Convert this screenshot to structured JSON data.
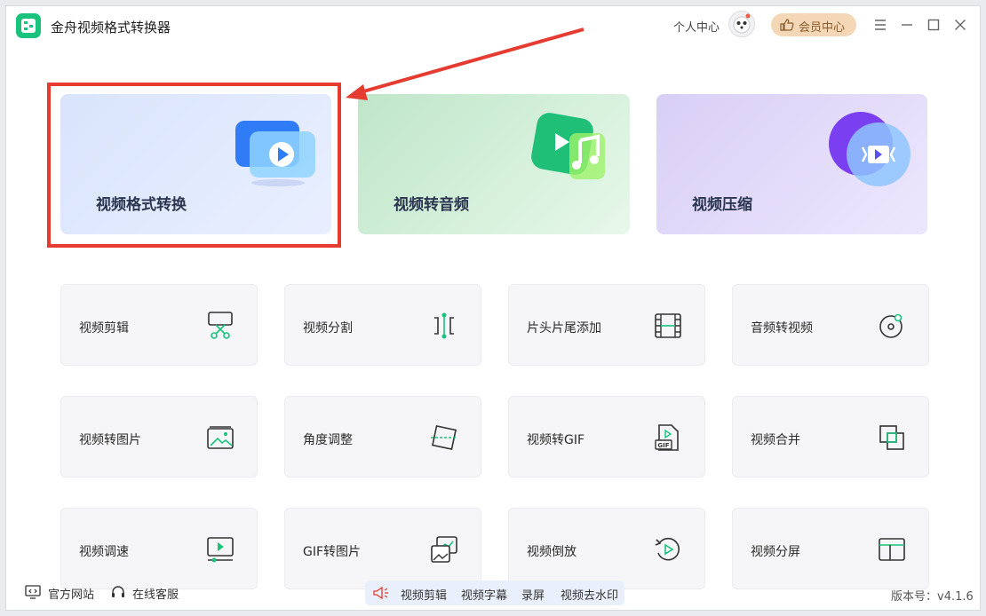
{
  "window": {
    "title": "金舟视频格式转换器"
  },
  "header": {
    "personal_center": "个人中心",
    "vip_center": "会员中心"
  },
  "feature_cards": [
    {
      "label": "视频格式转换",
      "icon": "video-play-icon"
    },
    {
      "label": "视频转音频",
      "icon": "music-note-icon"
    },
    {
      "label": "视频压缩",
      "icon": "compress-icon"
    }
  ],
  "tools": [
    {
      "label": "视频剪辑",
      "icon": "scissors-icon"
    },
    {
      "label": "视频分割",
      "icon": "split-icon"
    },
    {
      "label": "片头片尾添加",
      "icon": "film-strip-icon"
    },
    {
      "label": "音频转视频",
      "icon": "music-disc-icon"
    },
    {
      "label": "视频转图片",
      "icon": "image-icon"
    },
    {
      "label": "角度调整",
      "icon": "rotate-frame-icon"
    },
    {
      "label": "视频转GIF",
      "icon": "gif-file-icon"
    },
    {
      "label": "视频合并",
      "icon": "merge-icon"
    },
    {
      "label": "视频调速",
      "icon": "speed-icon"
    },
    {
      "label": "GIF转图片",
      "icon": "gif-image-icon"
    },
    {
      "label": "视频倒放",
      "icon": "reverse-play-icon"
    },
    {
      "label": "视频分屏",
      "icon": "split-screen-icon"
    }
  ],
  "footer": {
    "official_site": "官方网站",
    "online_service": "在线客服",
    "quick_links": [
      "视频剪辑",
      "视频字幕",
      "录屏",
      "视频去水印"
    ],
    "version": "版本号：v4.1.6"
  },
  "colors": {
    "accent_green": "#19c37d",
    "highlight_red": "#e53b30",
    "vip_bg": "#f3d7b6"
  }
}
